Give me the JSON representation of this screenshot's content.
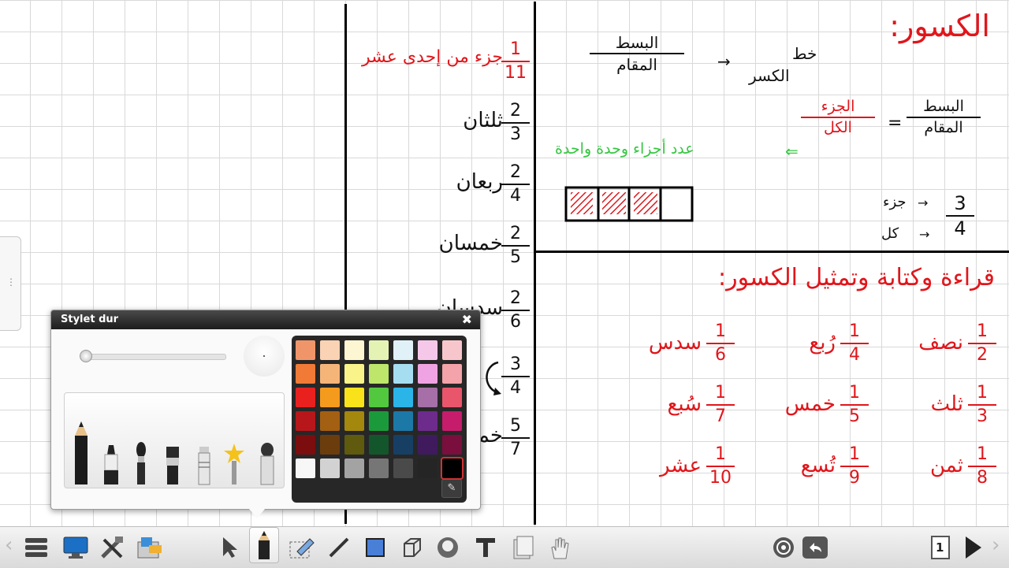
{
  "board": {
    "title": "الكسور:",
    "numerator_label": "البسط",
    "denominator_label": "المقام",
    "fraction_line_label": "خط الكسر",
    "fraction_line_label_top": "خط",
    "fraction_line_label_bottom": "الكسر",
    "arrow": "→",
    "equals": "=",
    "eq_num": "البسط",
    "eq_den": "المقام",
    "eq_part": "الجزء",
    "eq_whole": "الكل",
    "green_note": "عدد أجزاء وحدة واحدة",
    "example_num": "3",
    "example_den": "4",
    "example_part": "جزء",
    "example_whole": "كل",
    "heading2": "قراءة وكتابة وتمثيل الكسور:",
    "shaded_cells": 3,
    "total_cells": 4,
    "fractions_table": [
      {
        "num": "1",
        "den": "2",
        "name": "نصف"
      },
      {
        "num": "1",
        "den": "4",
        "name": "رُبع"
      },
      {
        "num": "1",
        "den": "6",
        "name": "سدس"
      },
      {
        "num": "1",
        "den": "3",
        "name": "ثلث"
      },
      {
        "num": "1",
        "den": "5",
        "name": "خمس"
      },
      {
        "num": "1",
        "den": "7",
        "name": "سُبع"
      },
      {
        "num": "1",
        "den": "8",
        "name": "ثمن"
      },
      {
        "num": "1",
        "den": "9",
        "name": "تُسع"
      },
      {
        "num": "1",
        "den": "10",
        "name": "عشر"
      }
    ],
    "middle_column": [
      {
        "num": "1",
        "den": "11",
        "name": "جزء من إحدى عشر"
      },
      {
        "num": "2",
        "den": "3",
        "name": "ثلثان"
      },
      {
        "num": "2",
        "den": "4",
        "name": "ربعان"
      },
      {
        "num": "2",
        "den": "5",
        "name": "خمسان"
      },
      {
        "num": "2",
        "den": "6",
        "name": "سدسان"
      },
      {
        "num": "3",
        "den": "4",
        "name": ""
      },
      {
        "num": "5",
        "den": "7",
        "name": "خمس"
      }
    ]
  },
  "palette": {
    "title": "Stylet dur",
    "close": "✖",
    "picker_icon": "eyedropper-icon",
    "colors": [
      "#f0956a",
      "#fad2b4",
      "#fdf6d2",
      "#e4f3b4",
      "#e0f1f7",
      "#f5c8ea",
      "#f7c6cc",
      "#f07a36",
      "#f5b478",
      "#f9f38a",
      "#bde66a",
      "#a7ddf1",
      "#f0a3e2",
      "#f3a3a9",
      "#e8211f",
      "#f49a1d",
      "#f9e21a",
      "#51c83e",
      "#2bb4e8",
      "#a66fa7",
      "#e9566c",
      "#b7171a",
      "#a35f12",
      "#a4880d",
      "#1b9a3b",
      "#1c78a6",
      "#6d2b8c",
      "#c61c6c",
      "#7b0d0e",
      "#6b3d0d",
      "#5f5a0e",
      "#14562b",
      "#173f64",
      "#3f1b5e",
      "#7a0f3d",
      "#f7f7f7",
      "#d2d2d2",
      "#a3a3a3",
      "#767676",
      "#4a4a4a",
      "#252525",
      "#000000"
    ],
    "selected_color": "#000000"
  },
  "toolbar": {
    "page_number": "1",
    "left_arrow": "‹",
    "right_arrow": "›"
  }
}
